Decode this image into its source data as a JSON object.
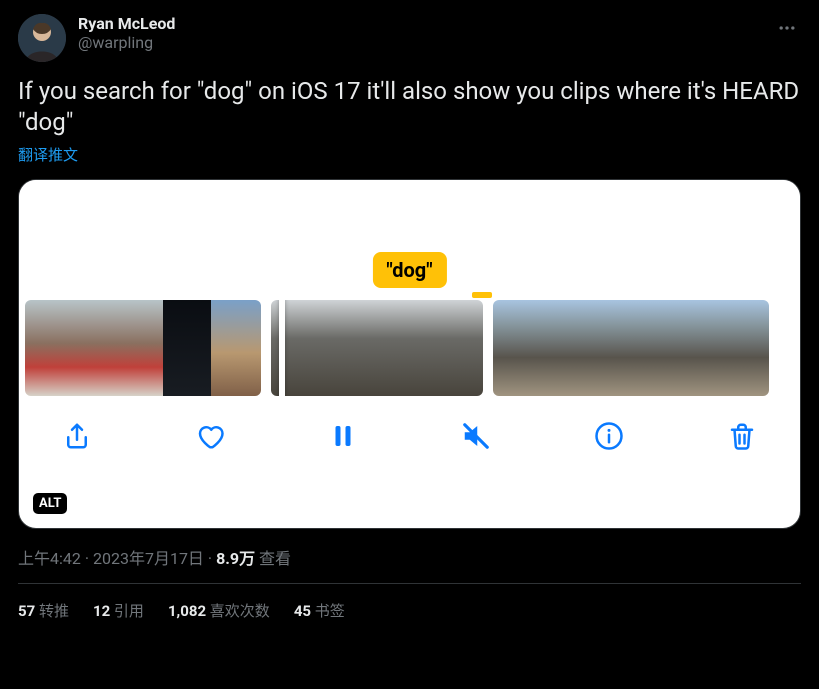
{
  "author": {
    "display_name": "Ryan McLeod",
    "handle": "@warpling"
  },
  "tweet_text": "If you search for \"dog\" on iOS 17 it'll also show you clips where it's HEARD \"dog\"",
  "translate_label": "翻译推文",
  "media": {
    "caption_bubble": "\"dog\"",
    "alt_badge": "ALT"
  },
  "meta": {
    "time": "上午4:42",
    "date": "2023年7月17日",
    "views_number": "8.9万",
    "views_label": "查看"
  },
  "stats": {
    "retweets_num": "57",
    "retweets_label": "转推",
    "quotes_num": "12",
    "quotes_label": "引用",
    "likes_num": "1,082",
    "likes_label": "喜欢次数",
    "bookmarks_num": "45",
    "bookmarks_label": "书签"
  }
}
